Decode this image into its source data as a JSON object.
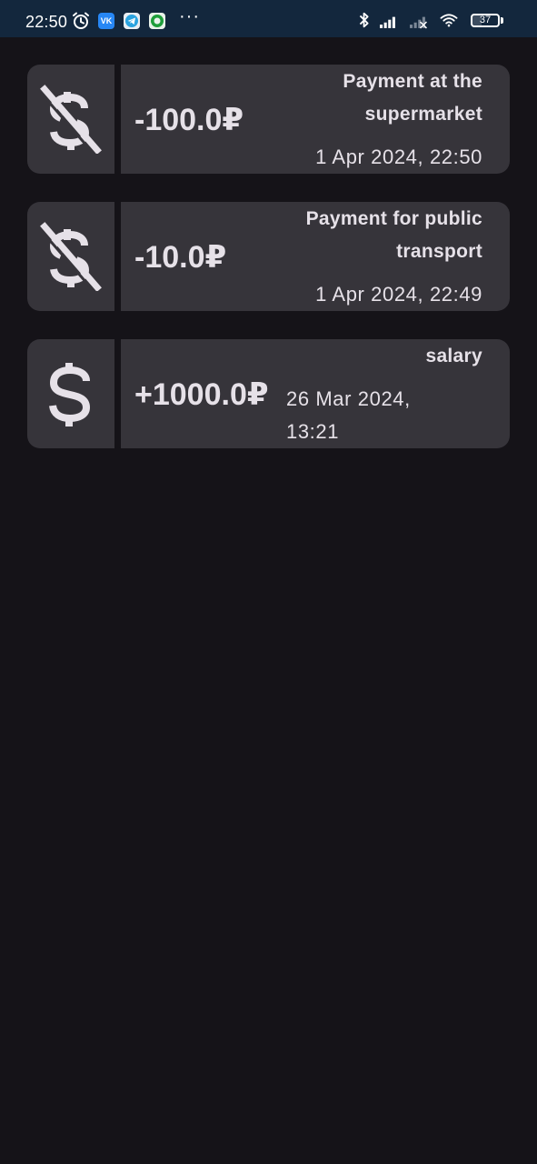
{
  "status_bar": {
    "time": "22:50",
    "notification_icons": [
      "alarm-icon",
      "vk-app-icon",
      "telegram-app-icon",
      "green-app-icon"
    ],
    "vk_label": "VK",
    "more": "···",
    "battery": "37",
    "battery_level": 0.37,
    "system_icons": [
      "bluetooth-icon",
      "signal-icon",
      "signal-off-icon",
      "wifi-icon",
      "battery-icon"
    ]
  },
  "transactions": [
    {
      "icon": "money-off-icon",
      "amount": "-100.0₽",
      "description": "Payment at the supermarket",
      "date": "1 Apr 2024, 22:50"
    },
    {
      "icon": "money-off-icon",
      "amount": "-10.0₽",
      "description": "Payment for public transport",
      "date": "1 Apr 2024, 22:49"
    },
    {
      "icon": "dollar-icon",
      "amount": "+1000.0₽",
      "description": "salary",
      "date": "26 Mar 2024, 13:21"
    }
  ],
  "colors": {
    "background": "#151318",
    "card": "#36343a",
    "text": "#e6e1e8",
    "status_bar": "#13273d"
  }
}
